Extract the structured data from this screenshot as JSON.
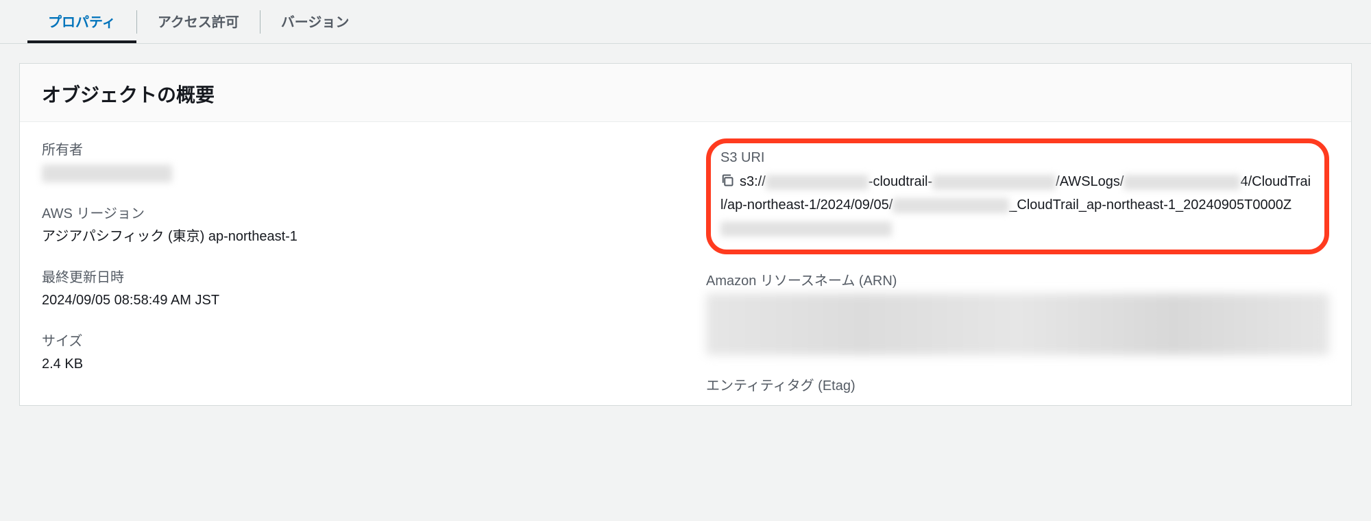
{
  "tabs": {
    "properties": "プロパティ",
    "permissions": "アクセス許可",
    "versions": "バージョン"
  },
  "panel": {
    "title": "オブジェクトの概要"
  },
  "left": {
    "owner_label": "所有者",
    "owner_value": "████████████",
    "region_label": "AWS リージョン",
    "region_value": "アジアパシフィック (東京) ap-northeast-1",
    "lastmod_label": "最終更新日時",
    "lastmod_value": "2024/09/05 08:58:49 AM JST",
    "size_label": "サイズ",
    "size_value": "2.4 KB"
  },
  "right": {
    "s3uri_label": "S3 URI",
    "s3uri_parts": {
      "p1": "s3://",
      "p2": "-cloudtrail-",
      "p3": "/AWSLogs/",
      "p4": "4/CloudTrail/ap-northeast-1/2024/09/05/",
      "p5": "_CloudTrail_ap-northeast-1_20240905T0000Z"
    },
    "arn_label": "Amazon リソースネーム (ARN)",
    "etag_label": "エンティティタグ (Etag)"
  }
}
